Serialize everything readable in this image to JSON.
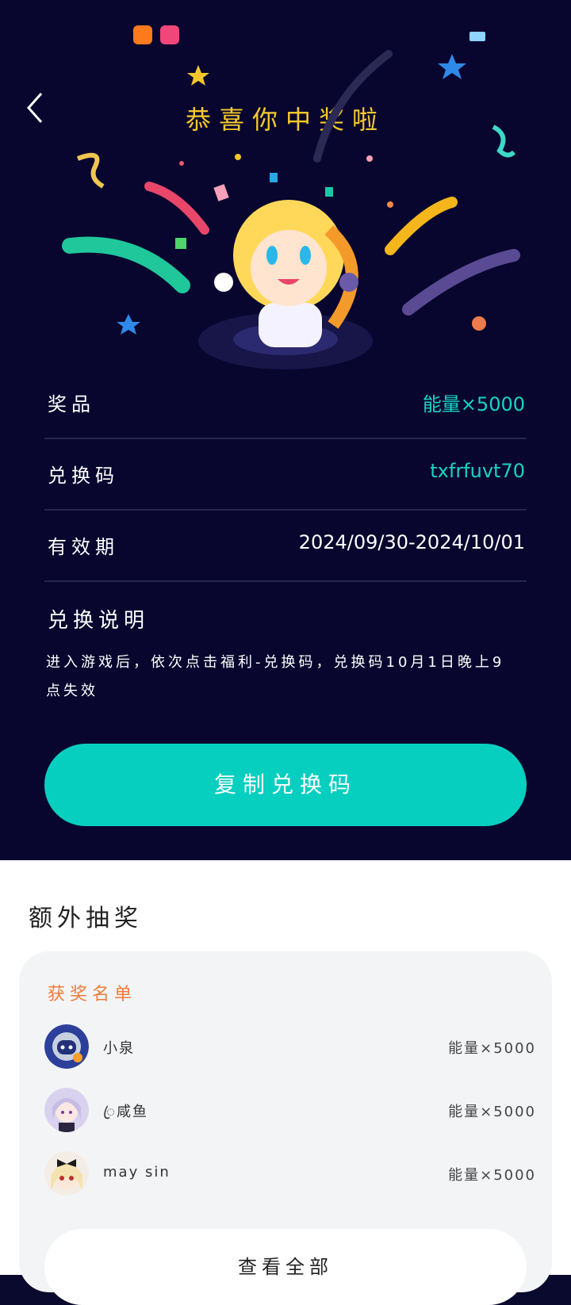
{
  "page": {
    "title": "恭喜你中奖啦"
  },
  "prize": {
    "prize_label": "奖品",
    "prize_value": "能量×5000",
    "code_label": "兑换码",
    "code_value": "txfrfuvt70",
    "validity_label": "有效期",
    "validity_value": "2024/09/30-2024/10/01",
    "desc_title": "兑换说明",
    "desc_text": "进入游戏后，依次点击福利-兑换码，兑换码10月1日晚上9点失效",
    "copy_button": "复制兑换码"
  },
  "extra": {
    "title": "额外抽奖",
    "winners_title": "获奖名单",
    "winners": [
      {
        "name": "小泉",
        "prize": "能量×5000"
      },
      {
        "name": "ꦿ咸鱼",
        "prize": "能量×5000"
      },
      {
        "name": "may sin",
        "prize": "能量×5000"
      }
    ],
    "view_all": "查看全部"
  },
  "colors": {
    "background": "#08062e",
    "accent": "#07cfc0",
    "title": "#f7c92d",
    "winners_title": "#ef7b3a"
  },
  "icons": {
    "back": "chevron-left-icon"
  }
}
